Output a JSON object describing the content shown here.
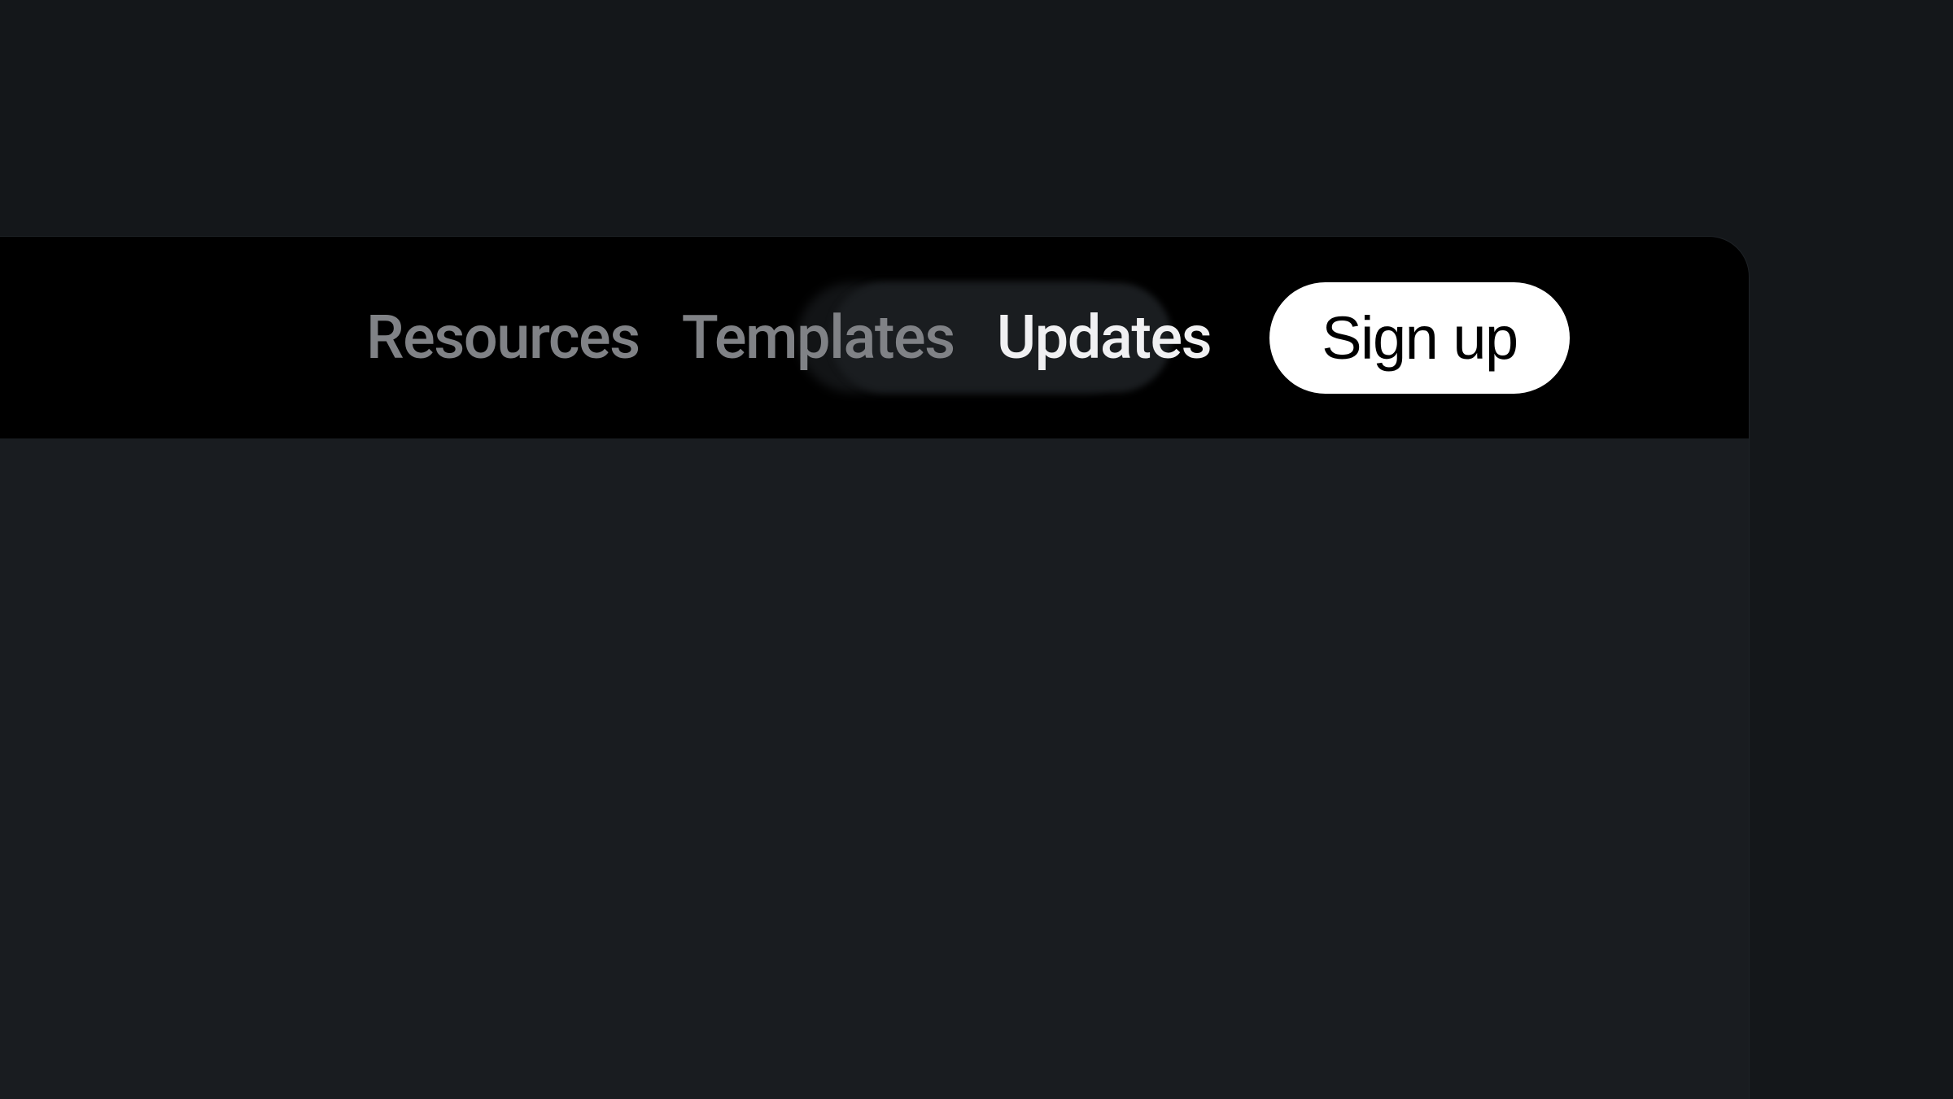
{
  "nav": {
    "items": [
      {
        "label": "Resources",
        "active": false
      },
      {
        "label": "Templates",
        "active": false
      },
      {
        "label": "Updates",
        "active": true
      }
    ],
    "signup_label": "Sign up"
  },
  "colors": {
    "background": "#14171a",
    "panel": "#000000",
    "content": "#191c20",
    "nav_inactive": "#808286",
    "nav_active": "#f0f0f2",
    "button_bg": "#ffffff",
    "button_text": "#000000",
    "hover_pill": "#1a1d20"
  }
}
